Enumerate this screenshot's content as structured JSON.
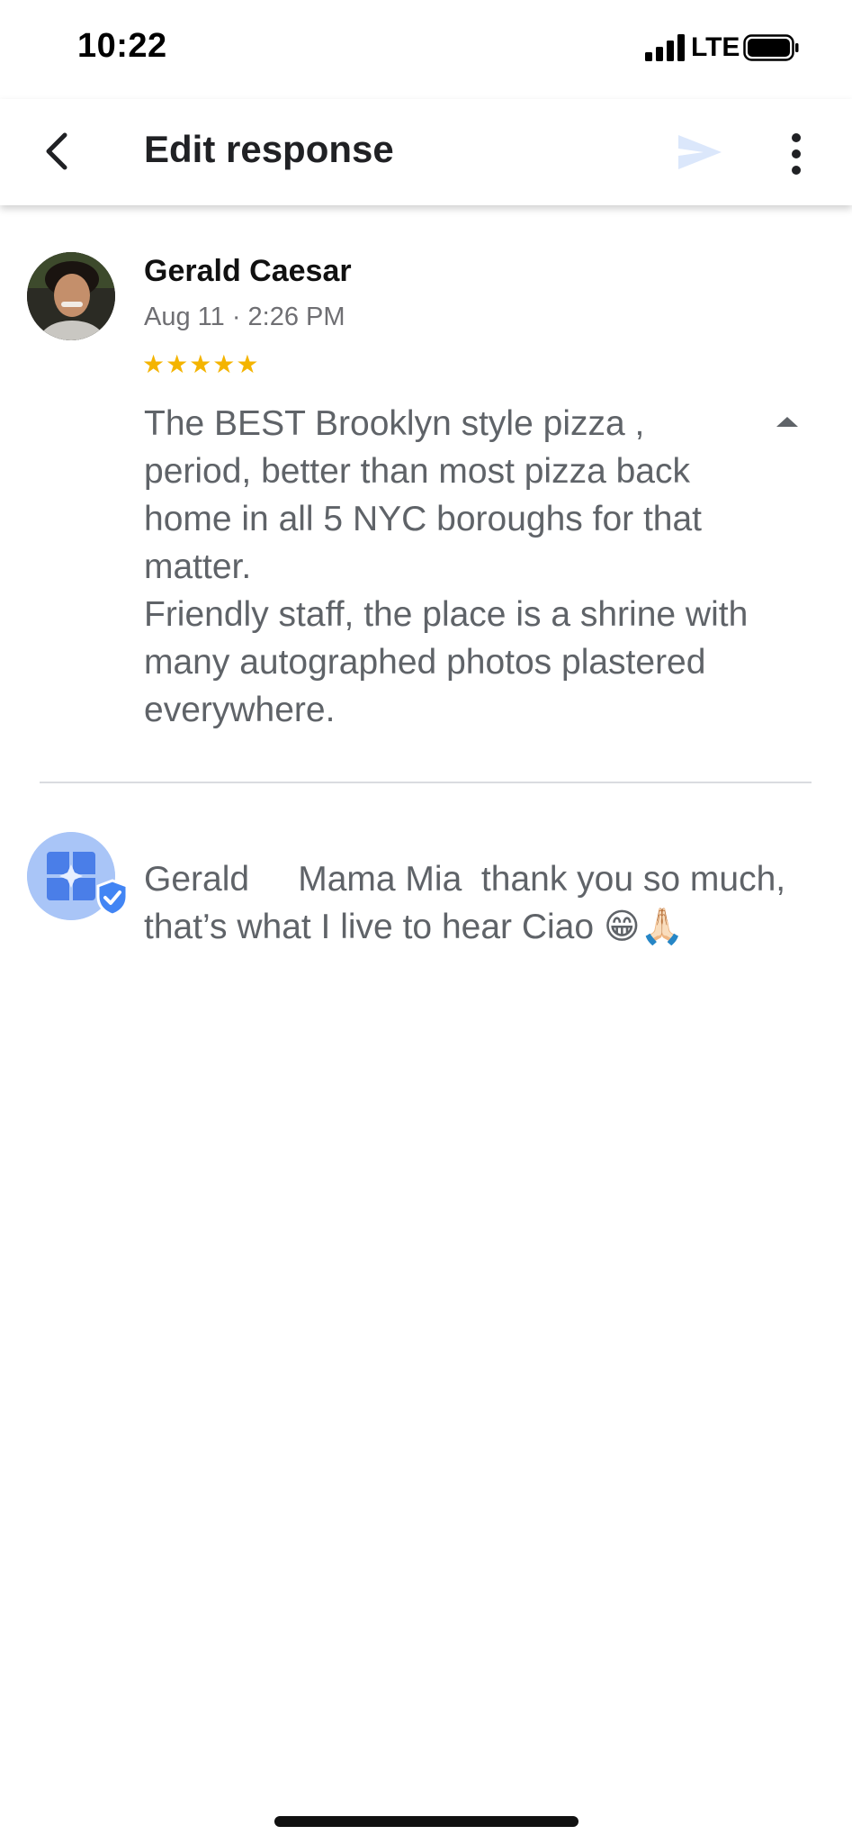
{
  "status_bar": {
    "time": "10:22",
    "network": "LTE"
  },
  "app_bar": {
    "title": "Edit response",
    "icons": {
      "back": "chevron-left-icon",
      "send": "send-icon",
      "more": "more-vert-icon"
    }
  },
  "review": {
    "reviewer_name": "Gerald Caesar",
    "date": "Aug 11 · 2:26 PM",
    "rating": 5,
    "stars": "★★★★★",
    "text": "The BEST Brooklyn style pizza , period, better than most pizza back home in all 5 NYC boroughs for that matter.\nFriendly staff, the place is a shrine with many autographed photos plastered everywhere."
  },
  "response": {
    "text": "Gerald     Mama Mia  thank you so much, that’s what I live to hear Ciao 😁🙏🏻"
  },
  "colors": {
    "star": "#f4b400",
    "owner_avatar_bg": "#a9c5f7",
    "owner_avatar_fg": "#4285f4",
    "send_disabled": "#dbe7fb",
    "body_text": "#5f6368"
  }
}
